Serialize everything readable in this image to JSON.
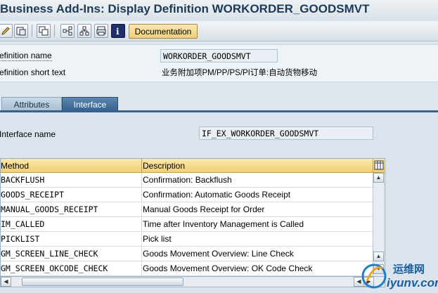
{
  "window": {
    "title": "Business Add-Ins: Display Definition WORKORDER_GOODSMVT"
  },
  "toolbar": {
    "icons": [
      "display-change-icon",
      "other-object-icon",
      "check-icon",
      "where-used-icon",
      "hierarchy-icon",
      "print-icon",
      "info-icon"
    ],
    "documentation_label": "Documentation"
  },
  "definition": {
    "name_label": "efinition name",
    "name_value": "WORKORDER_GOODSMVT",
    "short_text_label": "efinition short text",
    "short_text_value": "业务附加项PM/PP/PS/PI订单:自动货物移动"
  },
  "tabs": [
    {
      "label": "Attributes",
      "active": false
    },
    {
      "label": "Interface",
      "active": true
    }
  ],
  "interface": {
    "name_label": "Interface name",
    "name_value": "IF_EX_WORKORDER_GOODSMVT"
  },
  "methods_table": {
    "columns": [
      "Method",
      "Description"
    ],
    "rows": [
      {
        "method": "BACKFLUSH",
        "description": "Confirmation: Backflush"
      },
      {
        "method": "GOODS_RECEIPT",
        "description": "Confirmation: Automatic Goods Receipt"
      },
      {
        "method": "MANUAL_GOODS_RECEIPT",
        "description": "Manual Goods Receipt for Order"
      },
      {
        "method": "IM_CALLED",
        "description": "Time after Inventory Management is Called"
      },
      {
        "method": "PICKLIST",
        "description": "Pick list"
      },
      {
        "method": "GM_SCREEN_LINE_CHECK",
        "description": "Goods Movement Overview: Line Check"
      },
      {
        "method": "GM_SCREEN_OKCODE_CHECK",
        "description": "Goods Movement Overview: OK Code Check"
      }
    ]
  },
  "watermark": {
    "line1": "运维网",
    "line2": "iyunv.com"
  },
  "colors": {
    "accent": "#35628f",
    "header": "#f0cf72",
    "title": "#1d3a57"
  }
}
